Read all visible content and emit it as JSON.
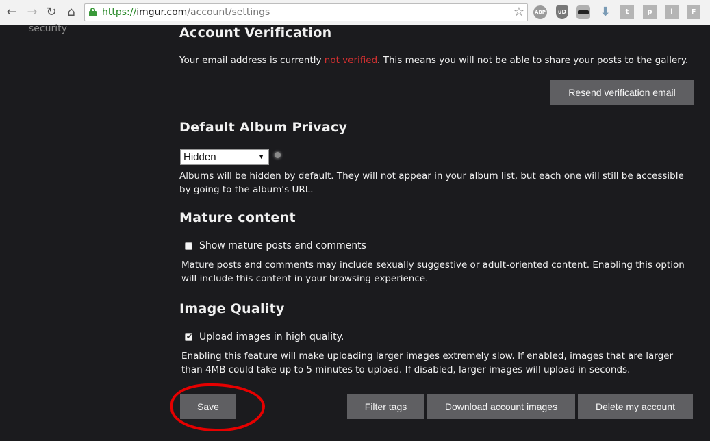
{
  "browser": {
    "url_scheme": "https://",
    "url_host": "imgur.com",
    "url_path": "/account/settings",
    "extensions": {
      "abp": "ABP",
      "ublock": "uD",
      "t": "t",
      "p": "p",
      "l": "l",
      "f": "F"
    }
  },
  "sidebar": {
    "item_security": "security"
  },
  "verification": {
    "heading": "Account Verification",
    "text_before": "Your email address is currently ",
    "text_status": "not verified",
    "text_after": ". This means you will not be able to share your posts to the gallery.",
    "resend_button": "Resend verification email",
    "status_color": "#d03030"
  },
  "album_privacy": {
    "heading": "Default Album Privacy",
    "selected": "Hidden",
    "description": "Albums will be hidden by default. They will not appear in your album list, but each one will still be accessible by going to the album's URL."
  },
  "mature": {
    "heading": "Mature content",
    "checkbox_label": "Show mature posts and comments",
    "checked": false,
    "description": "Mature posts and comments may include sexually suggestive or adult-oriented content. Enabling this option will include this content in your browsing experience."
  },
  "quality": {
    "heading": "Image Quality",
    "checkbox_label": "Upload images in high quality.",
    "checked": true,
    "description": "Enabling this feature will make uploading larger images extremely slow. If enabled, images that are larger than 4MB could take up to 5 minutes to upload. If disabled, larger images will upload in seconds."
  },
  "actions": {
    "save": "Save",
    "filter_tags": "Filter tags",
    "download_images": "Download account images",
    "delete_account": "Delete my account"
  },
  "colors": {
    "page_bg": "#1b1b1e",
    "button_bg": "#5f5f62",
    "annotation": "#e60000"
  }
}
